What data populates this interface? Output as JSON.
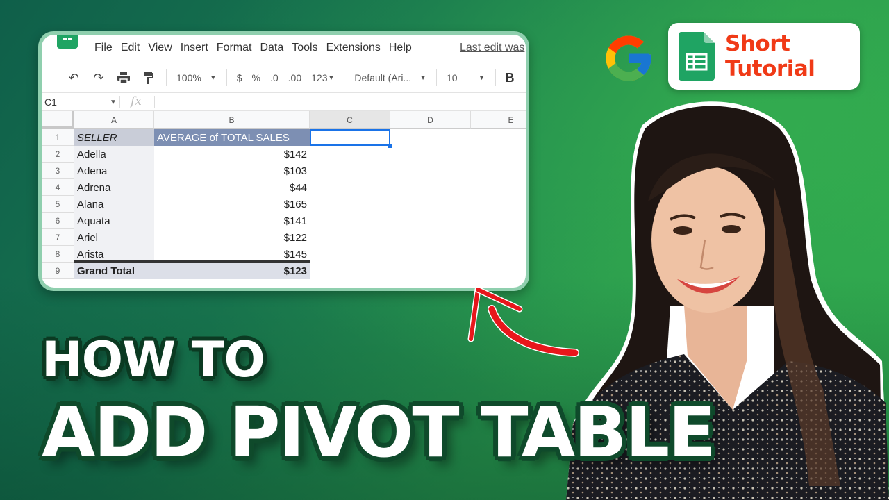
{
  "spreadsheet": {
    "menu": [
      "File",
      "Edit",
      "View",
      "Insert",
      "Format",
      "Data",
      "Tools",
      "Extensions",
      "Help"
    ],
    "last_edit": "Last edit was",
    "toolbar": {
      "undo_icon": "↶",
      "redo_icon": "↷",
      "print_icon": "🖶",
      "paint_format_icon": "🖌",
      "zoom": "100%",
      "currency": "$",
      "percent": "%",
      "decrease_decimal": ".0",
      "increase_decimal": ".00",
      "more_formats": "123",
      "font": "Default (Ari...",
      "font_size": "10",
      "bold": "B"
    },
    "name_box": "C1",
    "fx": "fx",
    "columns": [
      "A",
      "B",
      "C",
      "D",
      "E"
    ],
    "rows": [
      {
        "num": "1",
        "a": "SELLER",
        "b": "AVERAGE of TOTAL SALES"
      },
      {
        "num": "2",
        "a": "Adella",
        "b": "$142"
      },
      {
        "num": "3",
        "a": "Adena",
        "b": "$103"
      },
      {
        "num": "4",
        "a": "Adrena",
        "b": "$44"
      },
      {
        "num": "5",
        "a": "Alana",
        "b": "$165"
      },
      {
        "num": "6",
        "a": "Aquata",
        "b": "$141"
      },
      {
        "num": "7",
        "a": "Ariel",
        "b": "$122"
      },
      {
        "num": "8",
        "a": "Arista",
        "b": "$145"
      },
      {
        "num": "9",
        "a": "Grand Total",
        "b": "$123"
      }
    ],
    "selected_cell": "C1"
  },
  "branding": {
    "google_logo": "google-g-logo",
    "badge_line1": "Short",
    "badge_line2": "Tutorial"
  },
  "headline": {
    "line1": "HOW TO",
    "line2": "ADD PIVOT TABLE"
  },
  "colors": {
    "badge_text": "#f03a17",
    "pivot_header": "#7d8fb3",
    "selection": "#1a73e8",
    "sheets_green": "#1fa463",
    "arrow_red": "#e8161b"
  }
}
